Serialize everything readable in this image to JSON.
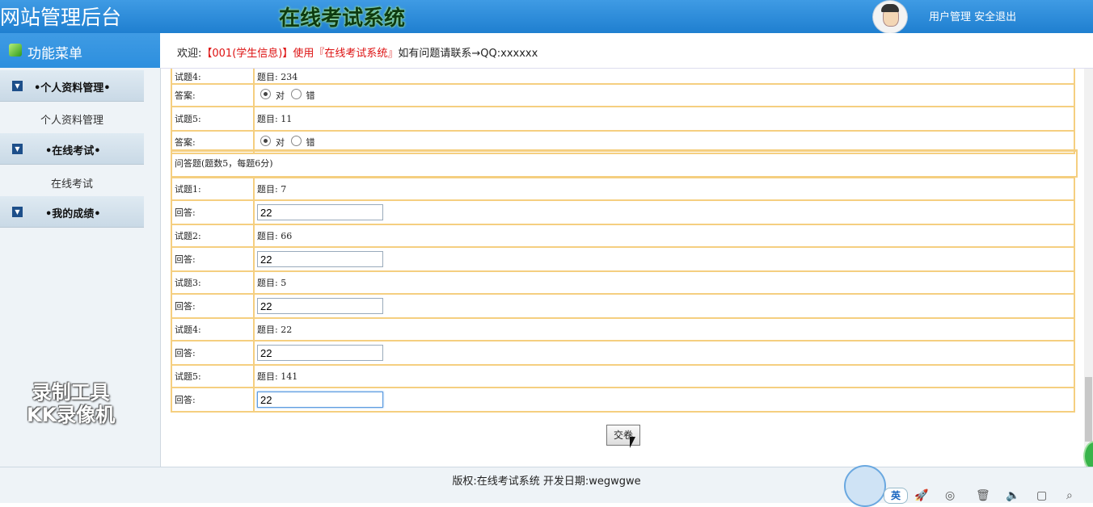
{
  "header": {
    "site_title": "网站管理后台",
    "system_title": "在线考试系统",
    "user_manage": "用户管理",
    "logout": "安全退出"
  },
  "menu": {
    "title": "功能菜单",
    "sections": [
      {
        "label": "•个人资料管理•",
        "items": [
          "个人资料管理"
        ]
      },
      {
        "label": "•在线考试•",
        "items": [
          "在线考试"
        ]
      },
      {
        "label": "•我的成绩•",
        "items": []
      }
    ]
  },
  "watermark": {
    "line1": "录制工具",
    "line2": "KK录像机"
  },
  "welcome": {
    "prefix": "欢迎:",
    "user": "【001(学生信息)】",
    "use": "使用",
    "system": "『在线考试系统』",
    "contact": "如有问题请联系→QQ:xxxxxx"
  },
  "judgment": {
    "partial_row": {
      "label": "试题4:",
      "question": "题目: 234"
    },
    "rows": [
      {
        "label": "答案:",
        "opt_true": "对",
        "opt_false": "错",
        "selected": "对"
      },
      {
        "label": "试题5:",
        "question": "题目: 11"
      },
      {
        "label": "答案:",
        "opt_true": "对",
        "opt_false": "错",
        "selected": "对"
      }
    ]
  },
  "essay": {
    "title": "问答题(题数5，每题6分)",
    "answer_label": "回答:",
    "questions": [
      {
        "label": "试题1:",
        "question": "题目: 7",
        "answer": "22"
      },
      {
        "label": "试题2:",
        "question": "题目: 66",
        "answer": "22"
      },
      {
        "label": "试题3:",
        "question": "题目: 5",
        "answer": "22"
      },
      {
        "label": "试题4:",
        "question": "题目: 22",
        "answer": "22"
      },
      {
        "label": "试题5:",
        "question": "题目: 141",
        "answer": "22"
      }
    ]
  },
  "submit_label": "交卷",
  "footer": {
    "copyright": "版权:在线考试系统 开发日期:wegwgwe"
  },
  "taskbar": {
    "ime": "英"
  }
}
